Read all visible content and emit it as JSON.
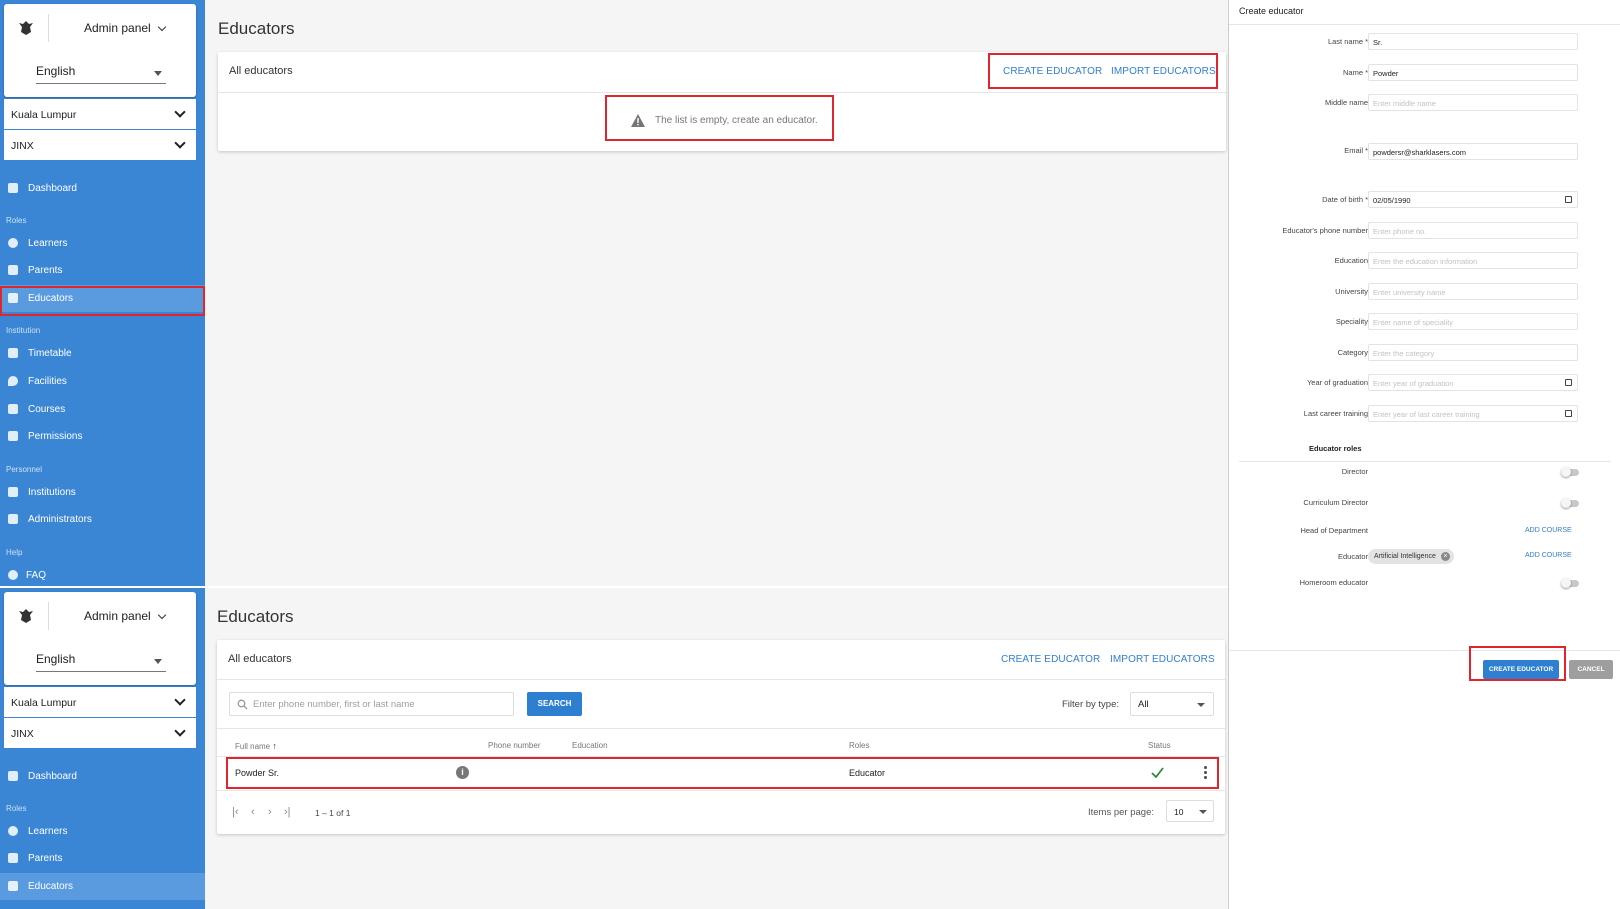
{
  "brand": {
    "logo_icon": "eagle-logo-icon",
    "admin_label": "Admin panel"
  },
  "language": "English",
  "city": "Kuala Lumpur",
  "school": "JINX",
  "sidebar": {
    "sections": {
      "roles": "Roles",
      "institution": "Institution",
      "personnel": "Personnel",
      "help": "Help"
    },
    "items": {
      "dashboard": "Dashboard",
      "learners": "Learners",
      "parents": "Parents",
      "educators": "Educators",
      "timetable": "Timetable",
      "facilities": "Facilities",
      "courses": "Courses",
      "permissions": "Permissions",
      "institutions": "Institutions",
      "administrators": "Administrators",
      "faq": "FAQ"
    }
  },
  "page": {
    "title": "Educators",
    "card_title": "All educators",
    "create_label": "CREATE EDUCATOR",
    "import_label": "IMPORT EDUCATORS",
    "empty_message": "The list is empty, create an educator."
  },
  "list": {
    "search_placeholder": "Enter phone number, first or last name",
    "search_button": "SEARCH",
    "filter_label": "Filter by type:",
    "filter_value": "All",
    "columns": {
      "full_name": "Full name",
      "phone": "Phone number",
      "education": "Education",
      "roles": "Roles",
      "status": "Status"
    },
    "row": {
      "full_name": "Powder Sr.",
      "roles": "Educator"
    },
    "range": "1 – 1 of 1",
    "items_per_page_label": "Items per page:",
    "items_per_page": "10"
  },
  "form": {
    "title": "Create educator",
    "fields": {
      "last_name": {
        "label": "Last name *",
        "value": "Sr."
      },
      "name": {
        "label": "Name *",
        "value": "Powder"
      },
      "middle_name": {
        "label": "Middle name",
        "placeholder": "Enter middle name"
      },
      "email": {
        "label": "Email *",
        "value": "powdersr@sharklasers.com"
      },
      "dob": {
        "label": "Date of birth *",
        "value": "02/05/1990"
      },
      "phone": {
        "label": "Educator's phone number",
        "placeholder": "Enter phone no."
      },
      "education": {
        "label": "Education",
        "placeholder": "Enter the education information"
      },
      "university": {
        "label": "University",
        "placeholder": "Enter university name"
      },
      "speciality": {
        "label": "Speciality",
        "placeholder": "Enter name of speciality"
      },
      "category": {
        "label": "Category",
        "placeholder": "Enter the category"
      },
      "graduation": {
        "label": "Year of graduation",
        "placeholder": "Enter year of graduation"
      },
      "training": {
        "label": "Last career training",
        "placeholder": "Enter year of last career training"
      }
    },
    "roles_title": "Educator roles",
    "roles": {
      "director": "Director",
      "curriculum_director": "Curriculum Director",
      "head_of_department": "Head of Department",
      "educator": "Educator",
      "homeroom": "Homeroom educator"
    },
    "add_course": "ADD COURSE",
    "educator_course": "Artificial Intelligence",
    "submit_label": "CREATE EDUCATOR",
    "cancel_label": "CANCEL"
  },
  "colors": {
    "sidebar": "#3a86d4",
    "accent": "#2f7fd0",
    "highlight": "#e0262c",
    "success": "#2e8b3a"
  }
}
